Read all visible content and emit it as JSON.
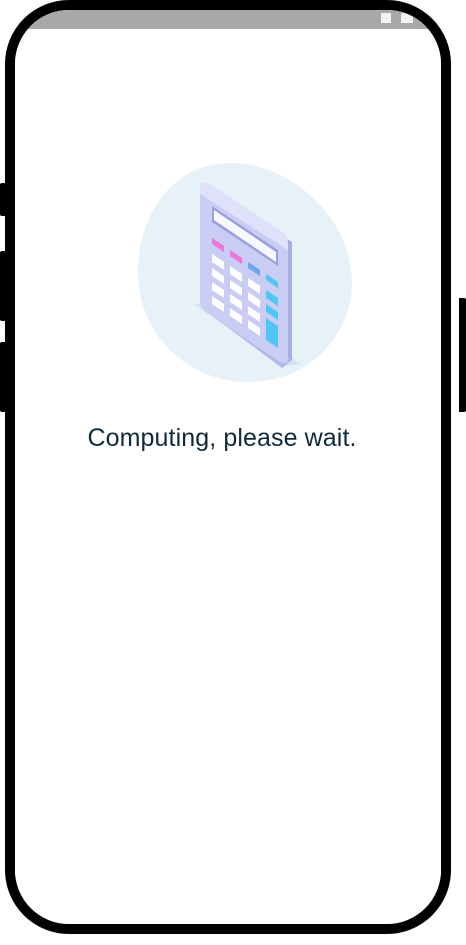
{
  "loading": {
    "message": "Computing, please wait.",
    "illustration_icon": "calculator-icon"
  },
  "colors": {
    "text": "#0f2a3d",
    "blob": "#e6f1f8",
    "status_bar": "#a8a8a8",
    "key_pink": "#ee74d6",
    "key_blue": "#6aa7ee",
    "key_cyan": "#4fc6f3",
    "calculator_body": "#c9cdf4"
  }
}
